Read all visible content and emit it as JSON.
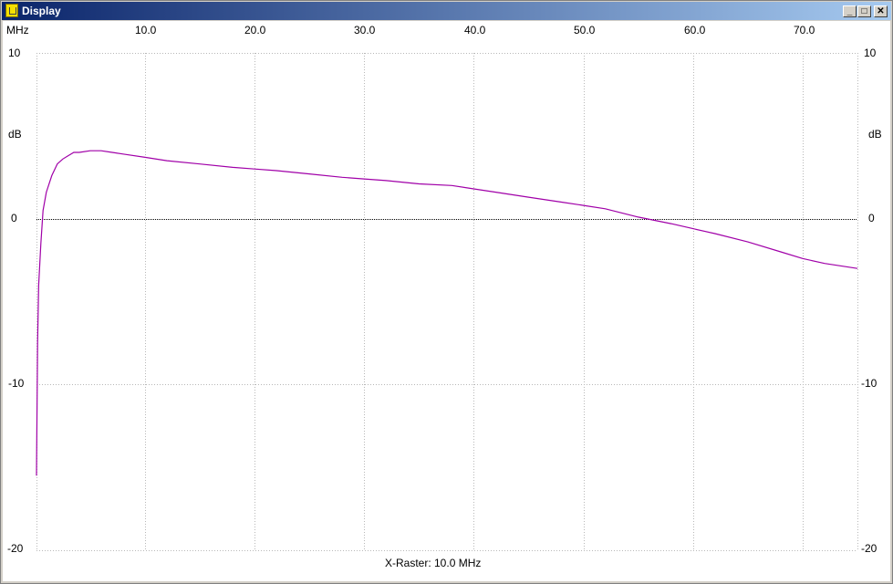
{
  "window": {
    "title": "Display",
    "minimize_label": "_",
    "maximize_label": "□",
    "close_label": "✕"
  },
  "plot": {
    "x_unit": "MHz",
    "y_unit": "dB",
    "x_ticks": [
      "10.0",
      "20.0",
      "30.0",
      "40.0",
      "50.0",
      "60.0",
      "70.0"
    ],
    "y_ticks_left": [
      "10",
      "0",
      "-10",
      "-20"
    ],
    "y_ticks_right": [
      "10",
      "0",
      "-10",
      "-20"
    ],
    "raster_label": "X-Raster: 10.0 MHz"
  },
  "colors": {
    "trace": "#a000a8",
    "grid": "#b8b8b8",
    "zero_line": "#000000",
    "title_gradient_start": "#0a246a",
    "title_gradient_end": "#a6caf0"
  },
  "chart_data": {
    "type": "line",
    "xlabel": "MHz",
    "ylabel": "dB",
    "xlim": [
      0.1,
      75.0
    ],
    "ylim": [
      -20,
      10
    ],
    "grid": true,
    "series": [
      {
        "x": [
          0.1,
          0.2,
          0.3,
          0.5,
          0.7,
          1.0,
          1.5,
          2.0,
          2.5,
          3.0,
          3.5,
          4.0,
          5.0,
          6.0,
          7.0,
          8.0,
          10.0,
          12.0,
          15.0,
          18.0,
          20.0,
          22.0,
          25.0,
          28.0,
          30.0,
          32.0,
          35.0,
          38.0,
          40.0,
          42.0,
          45.0,
          48.0,
          50.0,
          52.0,
          55.0,
          58.0,
          60.0,
          62.0,
          65.0,
          68.0,
          70.0,
          72.0,
          75.0
        ],
        "y": [
          -15.5,
          -7.5,
          -4.0,
          -1.5,
          0.5,
          1.6,
          2.6,
          3.3,
          3.6,
          3.8,
          4.0,
          4.0,
          4.1,
          4.1,
          4.0,
          3.9,
          3.7,
          3.5,
          3.3,
          3.1,
          3.0,
          2.9,
          2.7,
          2.5,
          2.4,
          2.3,
          2.1,
          2.0,
          1.8,
          1.6,
          1.3,
          1.0,
          0.8,
          0.6,
          0.1,
          -0.3,
          -0.6,
          -0.9,
          -1.4,
          -2.0,
          -2.4,
          -2.7,
          -3.0
        ]
      }
    ]
  }
}
